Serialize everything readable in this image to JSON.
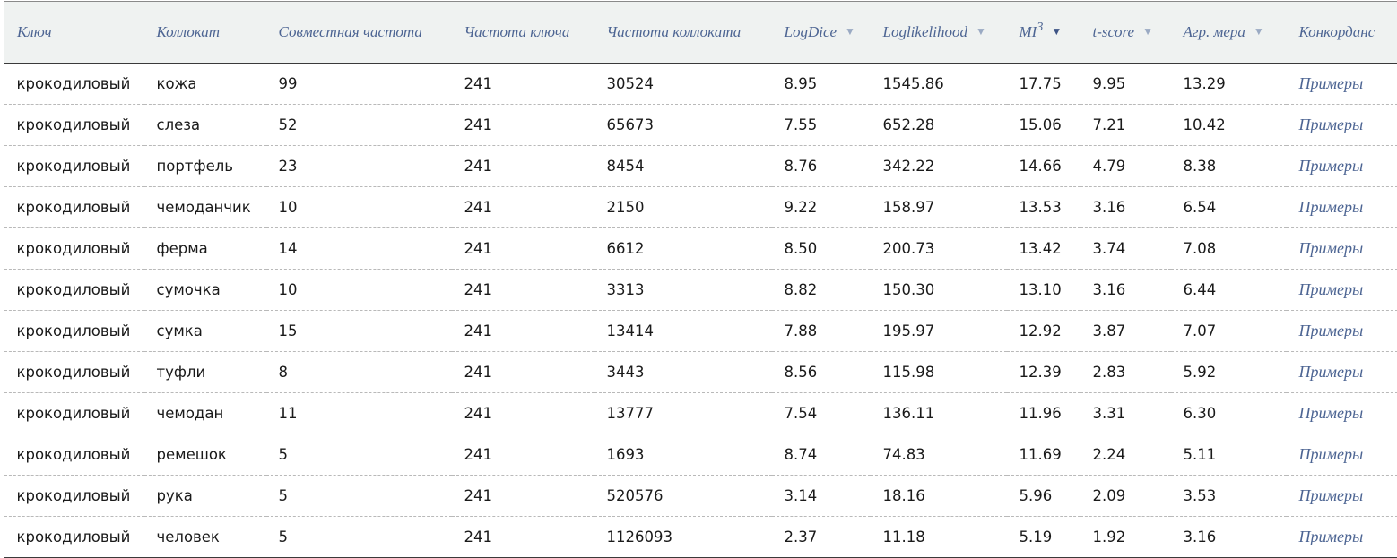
{
  "table": {
    "headers": {
      "key": "Ключ",
      "collocate": "Коллокат",
      "joint_freq": "Совместная частота",
      "key_freq": "Частота ключа",
      "collocate_freq": "Частота коллоката",
      "logdice": "LogDice",
      "loglikelihood": "Loglikelihood",
      "mi3_base": "MI",
      "mi3_sup": "3",
      "tscore": "t-score",
      "agr": "Агр. мера",
      "concordance": "Конкорданс"
    },
    "sort_column": "MI3",
    "sort_indicator": "▼",
    "rows": [
      [
        "крокодиловый",
        "кожа",
        "99",
        "241",
        "30524",
        "8.95",
        "1545.86",
        "17.75",
        "9.95",
        "13.29",
        "Примеры"
      ],
      [
        "крокодиловый",
        "слеза",
        "52",
        "241",
        "65673",
        "7.55",
        "652.28",
        "15.06",
        "7.21",
        "10.42",
        "Примеры"
      ],
      [
        "крокодиловый",
        "портфель",
        "23",
        "241",
        "8454",
        "8.76",
        "342.22",
        "14.66",
        "4.79",
        "8.38",
        "Примеры"
      ],
      [
        "крокодиловый",
        "чемоданчик",
        "10",
        "241",
        "2150",
        "9.22",
        "158.97",
        "13.53",
        "3.16",
        "6.54",
        "Примеры"
      ],
      [
        "крокодиловый",
        "ферма",
        "14",
        "241",
        "6612",
        "8.50",
        "200.73",
        "13.42",
        "3.74",
        "7.08",
        "Примеры"
      ],
      [
        "крокодиловый",
        "сумочка",
        "10",
        "241",
        "3313",
        "8.82",
        "150.30",
        "13.10",
        "3.16",
        "6.44",
        "Примеры"
      ],
      [
        "крокодиловый",
        "сумка",
        "15",
        "241",
        "13414",
        "7.88",
        "195.97",
        "12.92",
        "3.87",
        "7.07",
        "Примеры"
      ],
      [
        "крокодиловый",
        "туфли",
        "8",
        "241",
        "3443",
        "8.56",
        "115.98",
        "12.39",
        "2.83",
        "5.92",
        "Примеры"
      ],
      [
        "крокодиловый",
        "чемодан",
        "11",
        "241",
        "13777",
        "7.54",
        "136.11",
        "11.96",
        "3.31",
        "6.30",
        "Примеры"
      ],
      [
        "крокодиловый",
        "ремешок",
        "5",
        "241",
        "1693",
        "8.74",
        "74.83",
        "11.69",
        "2.24",
        "5.11",
        "Примеры"
      ],
      [
        "крокодиловый",
        "рука",
        "5",
        "241",
        "520576",
        "3.14",
        "18.16",
        "5.96",
        "2.09",
        "3.53",
        "Примеры"
      ],
      [
        "крокодиловый",
        "человек",
        "5",
        "241",
        "1126093",
        "2.37",
        "11.18",
        "5.19",
        "1.92",
        "3.16",
        "Примеры"
      ]
    ]
  },
  "colors": {
    "header_bg": "#eff2f1",
    "header_text": "#4d6593",
    "link": "#4d6593",
    "body_text": "#1a1a1a"
  }
}
